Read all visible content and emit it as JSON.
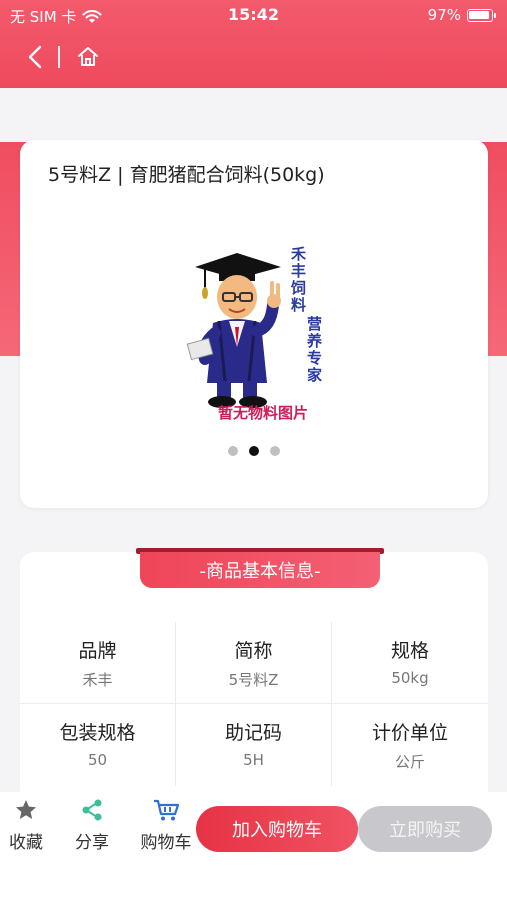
{
  "status": {
    "carrier": "无 SIM 卡",
    "time": "15:42",
    "battery": "97%"
  },
  "colors": {
    "brand": "#ee4a5e",
    "ribbon": "#ef4559",
    "disabled_button": "#c8c8cc"
  },
  "nav": {
    "back_icon": "chevron-left-icon",
    "home_icon": "home-icon"
  },
  "product": {
    "title": "5号料Z | 育肥猪配合饲料(50kg)",
    "image_placeholder_label": "暂无物料图片",
    "mascot_text_1": "禾丰饲料",
    "mascot_text_2": "营养专家",
    "carousel": {
      "count": 3,
      "active_index": 1
    }
  },
  "info": {
    "heading": "-商品基本信息-",
    "rows": [
      [
        {
          "label": "品牌",
          "value": "禾丰"
        },
        {
          "label": "简称",
          "value": "5号料Z"
        },
        {
          "label": "规格",
          "value": "50kg"
        }
      ],
      [
        {
          "label": "包装规格",
          "value": "50"
        },
        {
          "label": "助记码",
          "value": "5H"
        },
        {
          "label": "计价单位",
          "value": "公斤"
        }
      ]
    ]
  },
  "bottom": {
    "favorite": "收藏",
    "share": "分享",
    "cart": "购物车",
    "add_to_cart": "加入购物车",
    "buy_now": "立即购买"
  }
}
